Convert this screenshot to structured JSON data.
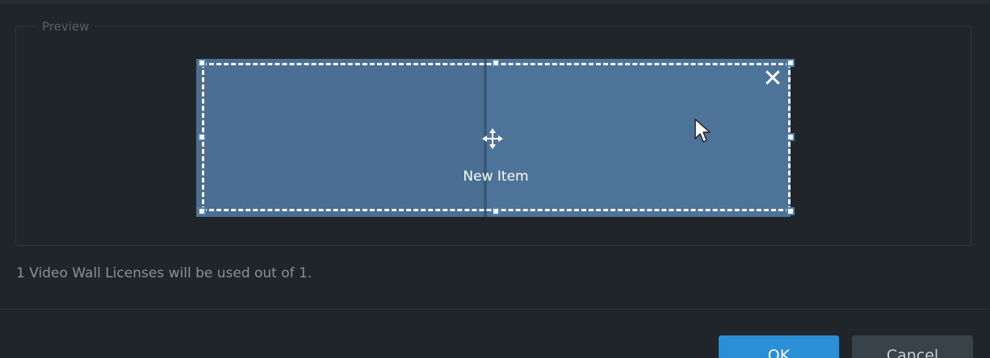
{
  "group": {
    "title": "Preview"
  },
  "preview": {
    "item_label": "New Item",
    "close_symbol": "✕",
    "icons": [
      "move-icon",
      "close-icon",
      "cursor-icon"
    ],
    "colors": {
      "screen": "#4a6f93",
      "selection": "#f2f4f6",
      "handle_border": "#4a7faf"
    }
  },
  "license": {
    "text": "1 Video Wall Licenses will be used out of 1."
  },
  "buttons": {
    "ok_label": "OK",
    "cancel_label": "Cancel"
  },
  "theme": {
    "background": "#1f2529",
    "accent": "#2b8fd6"
  }
}
